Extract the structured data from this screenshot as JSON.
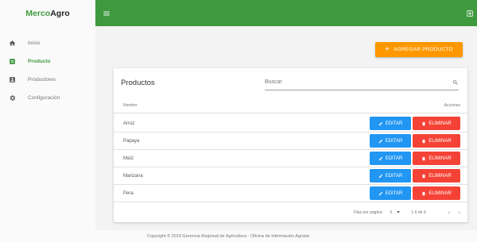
{
  "brand": {
    "part1": "Merco",
    "part2": "Agro"
  },
  "sidebar": {
    "items": [
      {
        "label": "Inicio",
        "icon": "home-icon",
        "active": false
      },
      {
        "label": "Producto",
        "icon": "product-icon",
        "active": true
      },
      {
        "label": "Productores",
        "icon": "producers-icon",
        "active": false
      },
      {
        "label": "Configuración",
        "icon": "settings-icon",
        "active": false
      }
    ]
  },
  "topbar": {
    "color": "#3f9a3f"
  },
  "add_button": {
    "label": "AGREGAR PRODUCTO",
    "color": "#ff9800"
  },
  "card": {
    "title": "Productos",
    "search_placeholder": "Buscar",
    "columns": {
      "name": "Nombre",
      "actions": "Acciones"
    },
    "rows": [
      {
        "name": "Arroz"
      },
      {
        "name": "Papaya"
      },
      {
        "name": "Maíz"
      },
      {
        "name": "Manzana"
      },
      {
        "name": "Pera"
      }
    ],
    "edit_label": "EDITAR",
    "delete_label": "ELIMINAR",
    "edit_color": "#2196f3",
    "delete_color": "#f44336"
  },
  "pagination": {
    "rows_per_page_label": "Filas por página:",
    "rows_per_page_value": "5",
    "range": "1-5 de 9",
    "prev": "‹",
    "next": "›"
  },
  "footer": {
    "text": "Copyright © 2019 Gerencia Regional de Agricultura - Oficina de Información Agraria"
  }
}
